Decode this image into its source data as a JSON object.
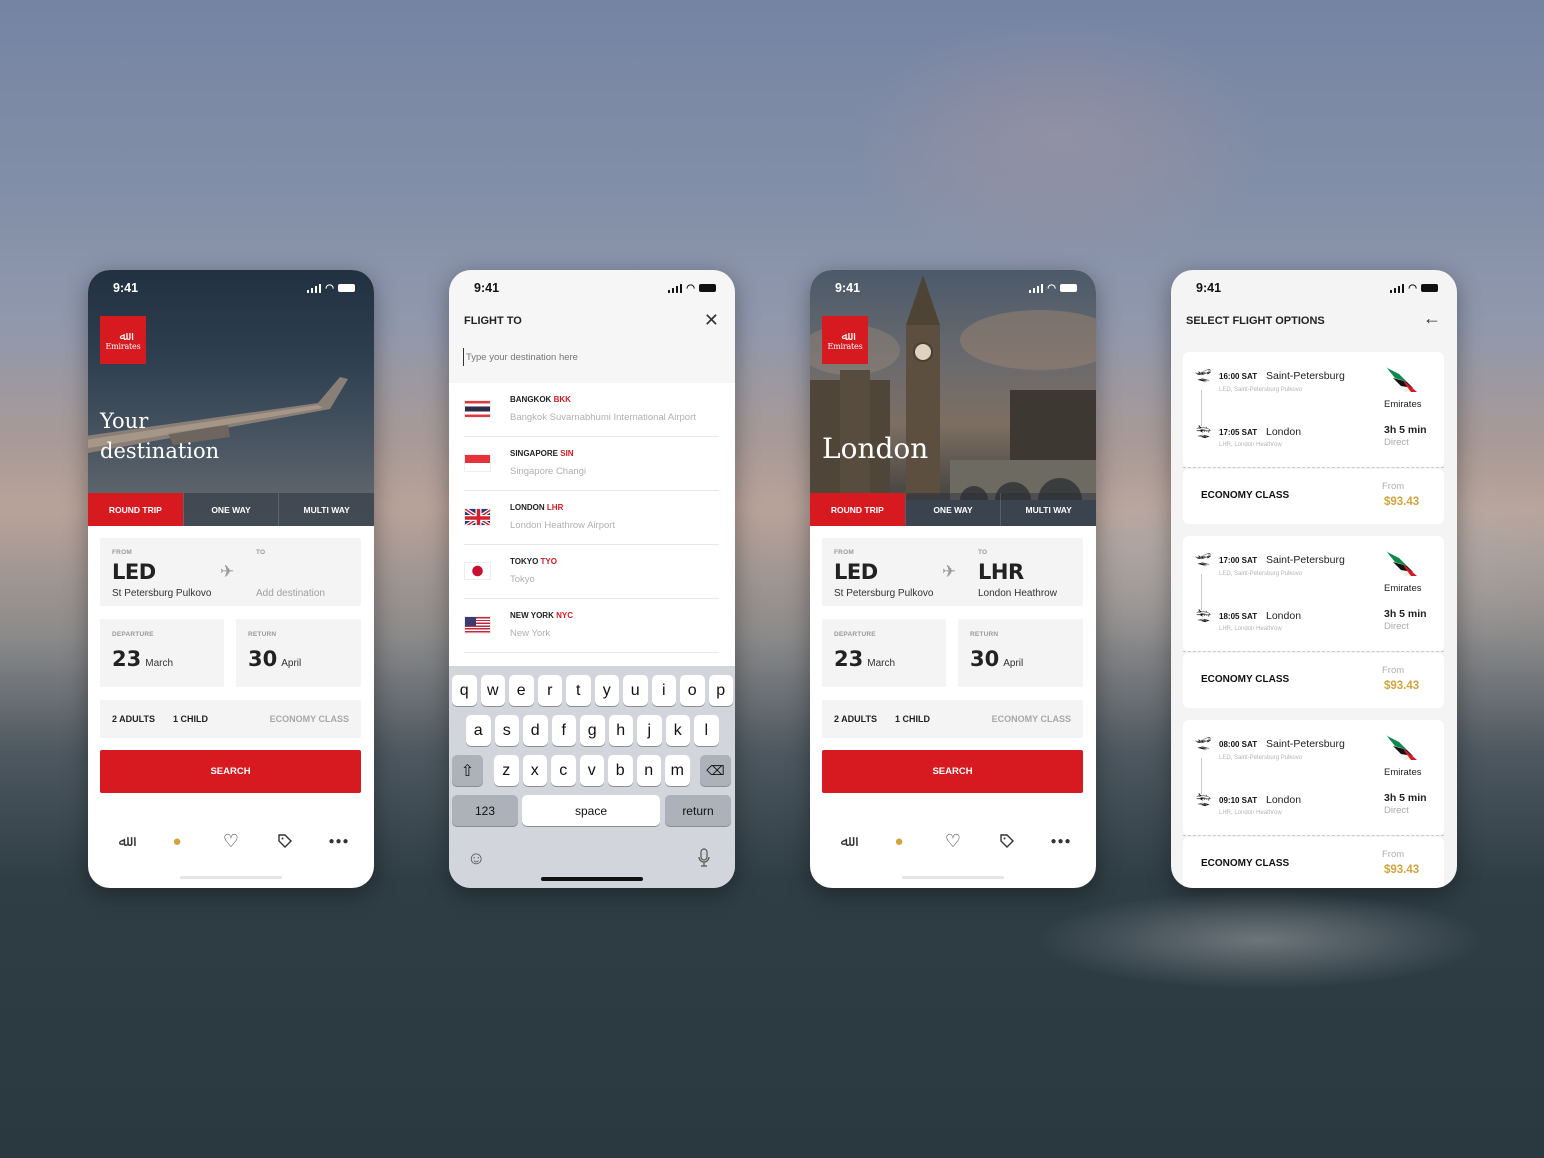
{
  "status_time": "9:41",
  "brand": {
    "name": "Emirates",
    "red": "#d71920",
    "gold": "#d4a33a"
  },
  "trip_tabs": [
    "ROUND TRIP",
    "ONE WAY",
    "MULTI WAY"
  ],
  "screen1": {
    "headline_line1": "Your",
    "headline_line2": "destination",
    "from_label": "FROM",
    "from_code": "LED",
    "from_name": "St Petersburg Pulkovo",
    "to_label": "TO",
    "to_placeholder": "Add destination",
    "departure_label": "DEPARTURE",
    "departure_day": "23",
    "departure_month": "March",
    "return_label": "RETURN",
    "return_day": "30",
    "return_month": "April",
    "adults": "2 ADULTS",
    "children": "1 CHILD",
    "cabin": "ECONOMY CLASS",
    "search_label": "SEARCH"
  },
  "screen2": {
    "title": "FLIGHT TO",
    "input_placeholder": "Type your destination here",
    "destinations": [
      {
        "city": "BANGKOK",
        "code": "BKK",
        "airport": "Bangkok Suvarnabhumi International Airport",
        "flag": "thailand"
      },
      {
        "city": "SINGAPORE",
        "code": "SIN",
        "airport": "Singapore Changi",
        "flag": "singapore"
      },
      {
        "city": "LONDON",
        "code": "LHR",
        "airport": "London Heathrow Airport",
        "flag": "uk"
      },
      {
        "city": "TOKYO",
        "code": "TYO",
        "airport": "Tokyo",
        "flag": "japan"
      },
      {
        "city": "NEW YORK",
        "code": "NYC",
        "airport": "New York",
        "flag": "usa"
      }
    ],
    "keyboard": {
      "row1": [
        "q",
        "w",
        "e",
        "r",
        "t",
        "y",
        "u",
        "i",
        "o",
        "p"
      ],
      "row2": [
        "a",
        "s",
        "d",
        "f",
        "g",
        "h",
        "j",
        "k",
        "l"
      ],
      "row3": [
        "z",
        "x",
        "c",
        "v",
        "b",
        "n",
        "m"
      ],
      "numbers": "123",
      "space": "space",
      "return": "return"
    }
  },
  "screen3": {
    "headline": "London",
    "from_label": "FROM",
    "from_code": "LED",
    "from_name": "St Petersburg Pulkovo",
    "to_label": "TO",
    "to_code": "LHR",
    "to_name": "London Heathrow",
    "departure_label": "DEPARTURE",
    "departure_day": "23",
    "departure_month": "March",
    "return_label": "RETURN",
    "return_day": "30",
    "return_month": "April",
    "adults": "2 ADULTS",
    "children": "1 CHILD",
    "cabin": "ECONOMY CLASS",
    "search_label": "SEARCH"
  },
  "screen4": {
    "title": "SELECT FLIGHT OPTIONS",
    "flights": [
      {
        "dep_time": "16:00 SAT",
        "dep_city": "Saint-Petersburg",
        "dep_airport": "LED, Saint-Petersburg Pulkovo",
        "arr_time": "17:05 SAT",
        "arr_city": "London",
        "arr_airport": "LHR, London Heathrow",
        "airline": "Emirates",
        "duration": "3h 5 min",
        "stops": "Direct",
        "cabin": "ECONOMY CLASS",
        "from_label": "From",
        "price": "$93.43"
      },
      {
        "dep_time": "17:00 SAT",
        "dep_city": "Saint-Petersburg",
        "dep_airport": "LED, Saint-Petersburg Pulkovo",
        "arr_time": "18:05 SAT",
        "arr_city": "London",
        "arr_airport": "LHR, London Heathrow",
        "airline": "Emirates",
        "duration": "3h 5 min",
        "stops": "Direct",
        "cabin": "ECONOMY CLASS",
        "from_label": "From",
        "price": "$93.43"
      },
      {
        "dep_time": "08:00 SAT",
        "dep_city": "Saint-Petersburg",
        "dep_airport": "LED, Saint-Petersburg Pulkovo",
        "arr_time": "09:10 SAT",
        "arr_city": "London",
        "arr_airport": "LHR, London Heathrow",
        "airline": "Emirates",
        "duration": "3h 5 min",
        "stops": "Direct",
        "cabin": "ECONOMY CLASS",
        "from_label": "From",
        "price": "$93.43"
      }
    ]
  },
  "bottom_nav": [
    {
      "icon": "emirates-calligraphy-icon",
      "glyph": "⚘",
      "active": false
    },
    {
      "icon": "globe-icon",
      "glyph": "🌍",
      "active": true
    },
    {
      "icon": "heart-icon",
      "glyph": "♡",
      "active": false
    },
    {
      "icon": "tag-icon",
      "glyph": "⌲",
      "active": false
    },
    {
      "icon": "more-icon",
      "glyph": "•••",
      "active": false
    }
  ]
}
